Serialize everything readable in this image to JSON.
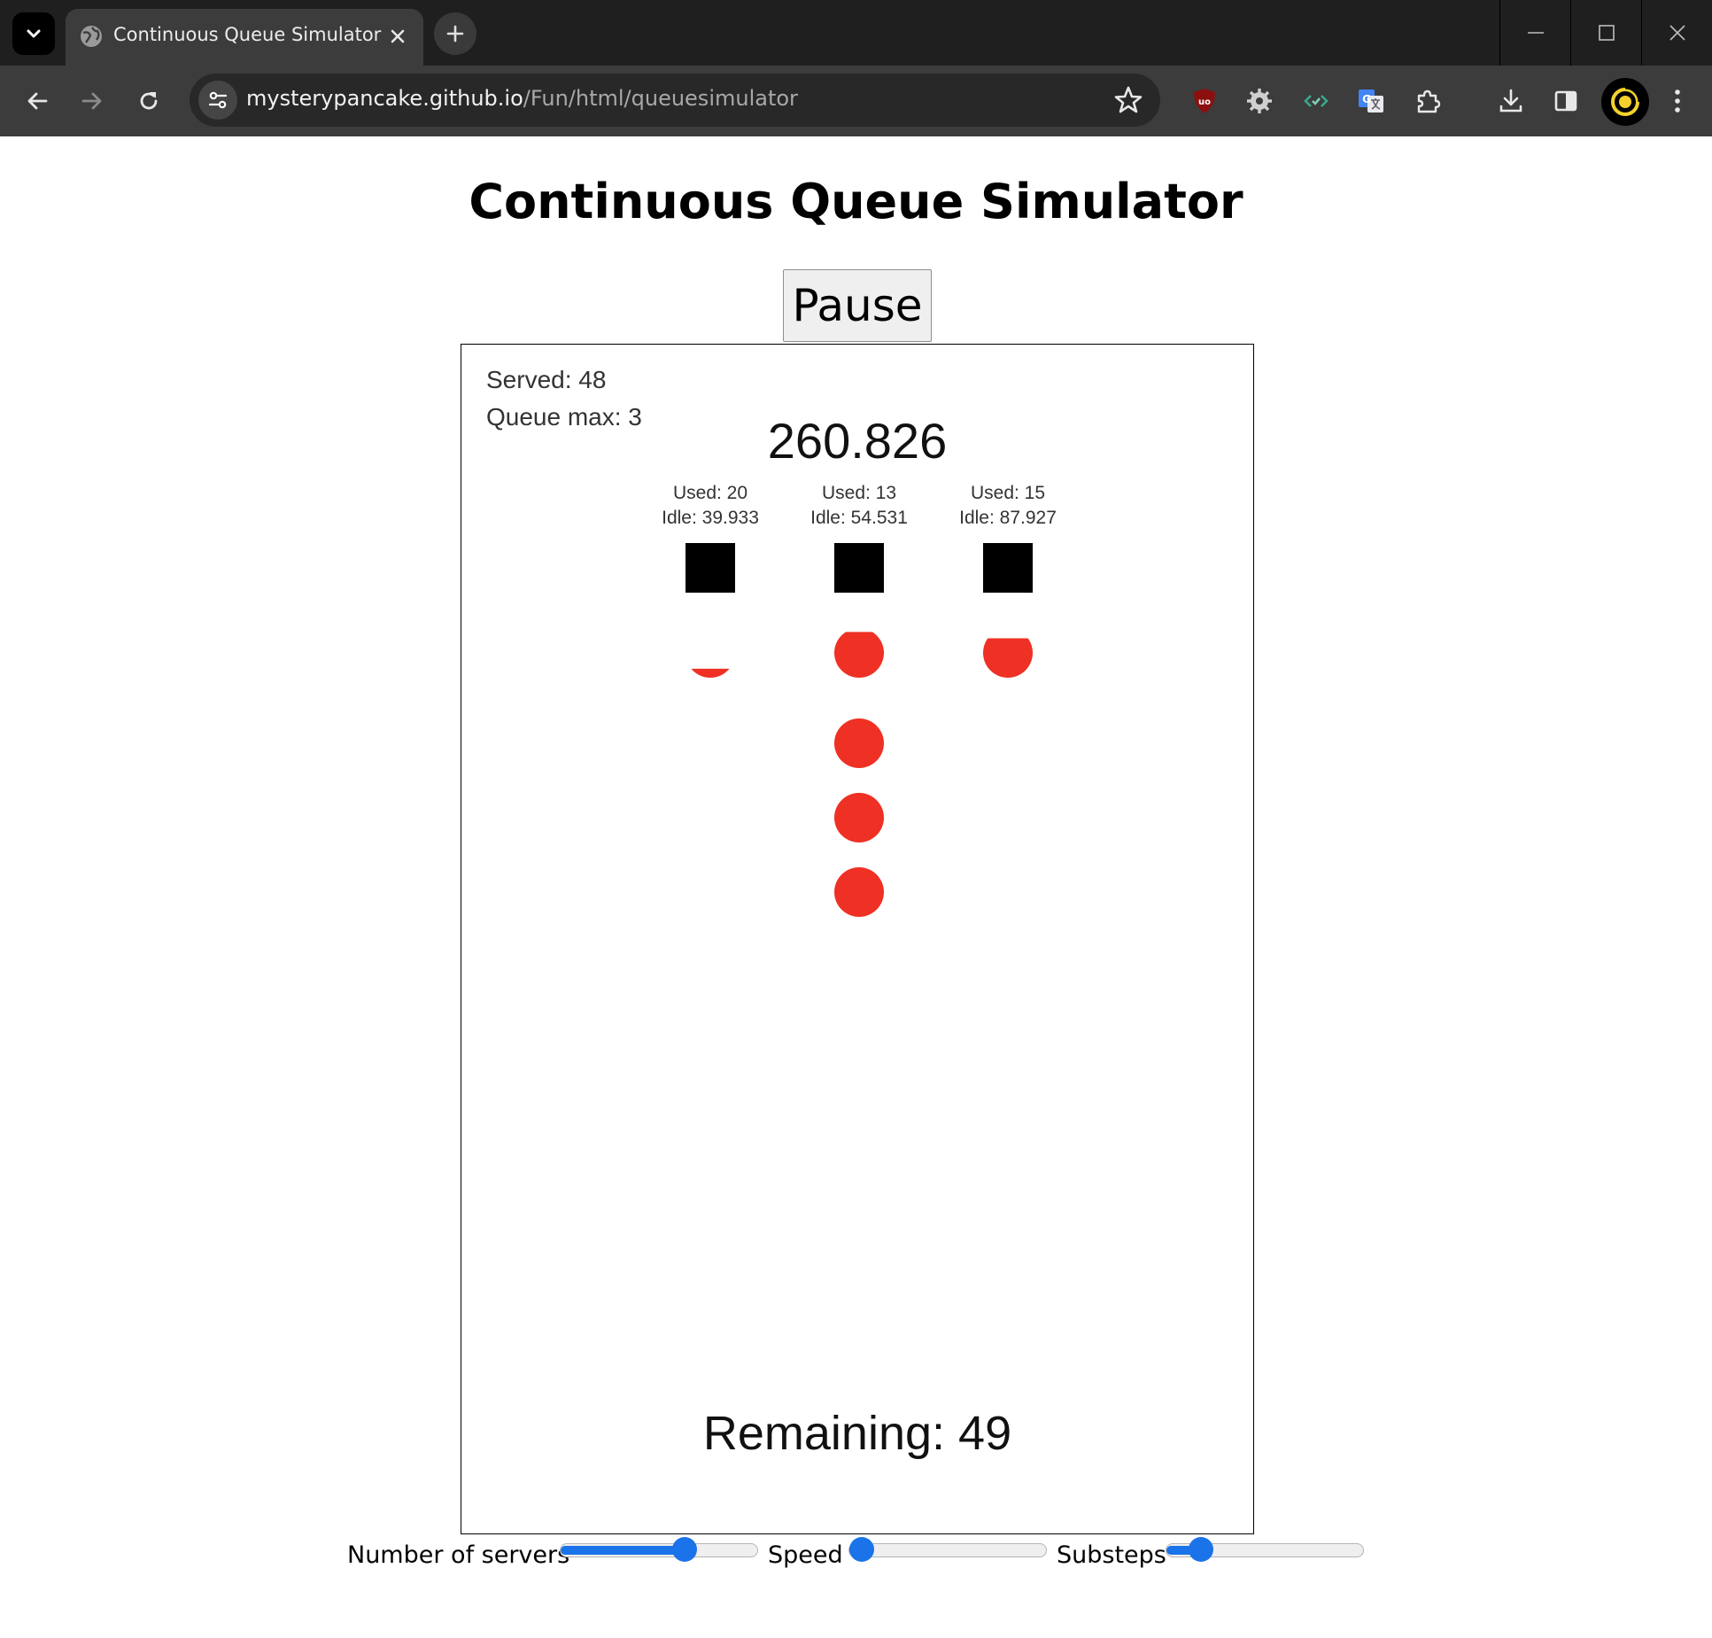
{
  "browser": {
    "tab_title": "Continuous Queue Simulator",
    "url_host": "mysterypancake.github.io",
    "url_path": "/Fun/html/queuesimulator"
  },
  "page": {
    "title": "Continuous Queue Simulator",
    "pause_label": "Pause"
  },
  "simulation": {
    "served": "Served: 48",
    "queue_max": "Queue max: 3",
    "clock": "260.826",
    "servers": [
      {
        "used": "Used: 20",
        "idle": "Idle: 39.933",
        "progress": 0.72
      },
      {
        "used": "Used: 13",
        "idle": "Idle: 54.531",
        "progress": 0.18
      },
      {
        "used": "Used: 15",
        "idle": "Idle: 87.927",
        "progress": 0.3
      }
    ],
    "queue_length": 3,
    "remaining": "Remaining: 49",
    "customer_color": "#ee3124",
    "server_color": "#000000"
  },
  "controls": {
    "servers_label": "Number of servers",
    "speed_label": "Speed",
    "substeps_label": "Substeps",
    "servers_value": 0.65,
    "speed_value": 0.0,
    "substeps_value": 0.13,
    "accent_color": "#1a73e8"
  }
}
